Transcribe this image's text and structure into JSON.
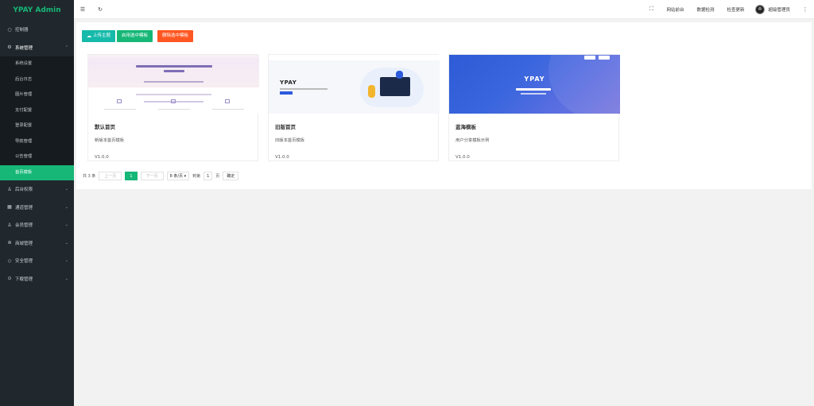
{
  "brand": "YPAY Admin",
  "sidebar": {
    "dashboard": "控制器",
    "system": "系统管理",
    "system_items": [
      "系统设置",
      "后台日志",
      "图片管理",
      "支付配置",
      "登录配置",
      "导航管理",
      "公告管理",
      "首页模板"
    ],
    "others": [
      "后台权限",
      "通道管理",
      "会员管理",
      "商城管理",
      "安全管理",
      "下载管理"
    ]
  },
  "topbar": {
    "links": [
      "网站前台",
      "数据检测",
      "检查更新"
    ],
    "user": "超级管理员"
  },
  "actions": {
    "upload": "上传主题",
    "enable": "启用选中模板",
    "delete": "删除选中模板"
  },
  "cards": [
    {
      "title": "默认首页",
      "desc": "新版本首页模板",
      "version": "V1.0.0"
    },
    {
      "title": "旧版首页",
      "desc": "旧版本首页模板",
      "version": "V1.0.0"
    },
    {
      "title": "蓝海模板",
      "desc": "用户分享模板示例",
      "version": "V1.0.0"
    }
  ],
  "pager": {
    "total": "共 3 条",
    "prev": "上一页",
    "current": "1",
    "next": "下一页",
    "page_size": "8 条/页",
    "goto": "到第",
    "goto_value": "1",
    "page_unit": "页",
    "confirm": "确定"
  },
  "thumb_text": {
    "card2_logo": "YPAY",
    "card3_logo": "YPAY"
  },
  "colors": {
    "accent": "#16b777",
    "teal": "#16baaa",
    "danger": "#ff5722",
    "sidebar": "#20282d"
  }
}
